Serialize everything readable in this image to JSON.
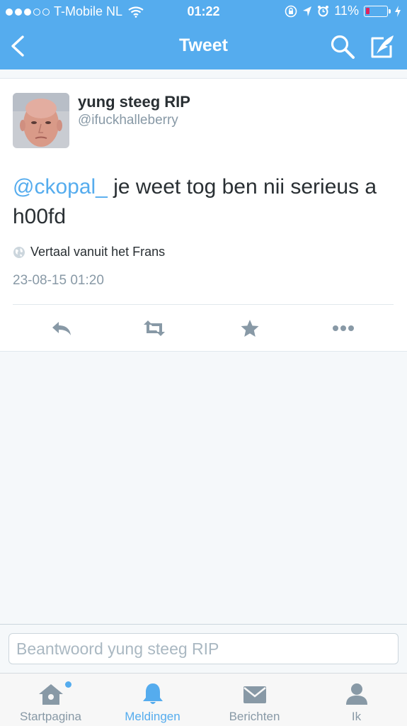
{
  "status_bar": {
    "carrier": "T-Mobile NL",
    "time": "01:22",
    "battery": "11%",
    "battery_level": 0.11
  },
  "nav": {
    "title": "Tweet"
  },
  "tweet": {
    "name": "yung steeg RIP",
    "handle": "@ifuckhalleberry",
    "mention": "@ckopal_",
    "text": " je weet tog ben nii serieus a h00fd",
    "translate_label": "Vertaal vanuit het Frans",
    "timestamp": "23-08-15 01:20"
  },
  "reply": {
    "placeholder": "Beantwoord yung steeg RIP"
  },
  "tabbar": {
    "items": [
      {
        "label": "Startpagina",
        "icon": "home-icon"
      },
      {
        "label": "Meldingen",
        "icon": "bell-icon",
        "active": true
      },
      {
        "label": "Berichten",
        "icon": "envelope-icon"
      },
      {
        "label": "Ik",
        "icon": "person-icon"
      }
    ]
  },
  "colors": {
    "accent": "#55acee",
    "muted": "#8899a6",
    "text": "#292f33"
  }
}
